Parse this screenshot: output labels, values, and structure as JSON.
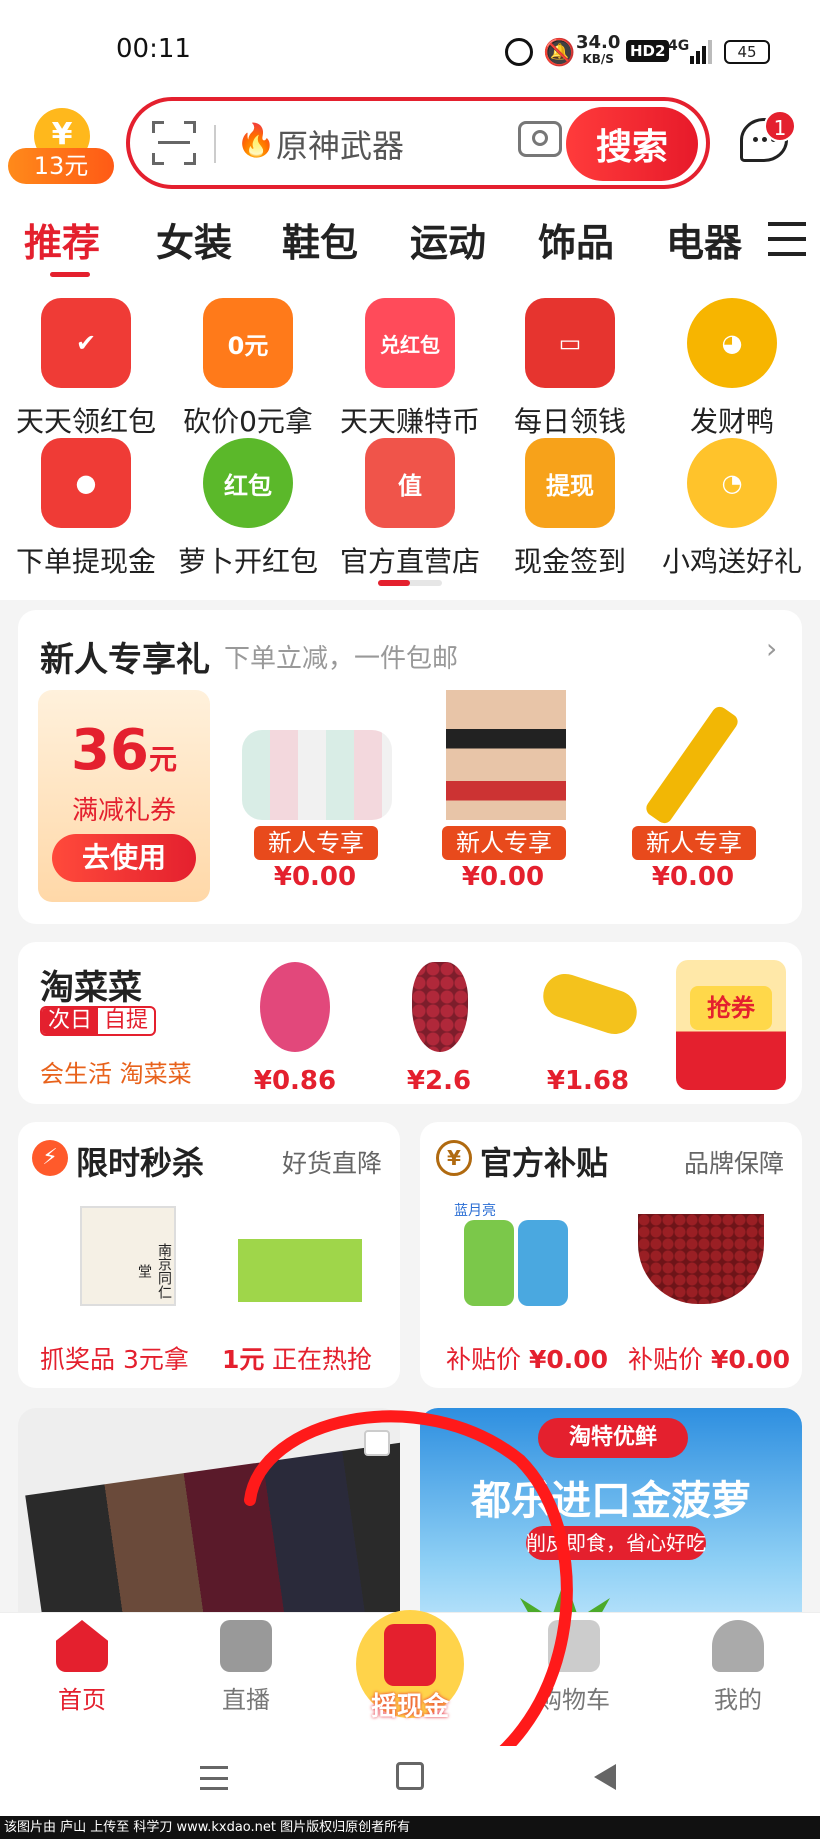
{
  "status_bar": {
    "time": "00:11",
    "speed": "34.0",
    "speed_unit": "KB/S",
    "hd": "HD2",
    "net": "4G",
    "battery": "45"
  },
  "header": {
    "coin_amount": "13元",
    "coin_symbol": "¥",
    "search_placeholder": "原神武器",
    "search_button": "搜索",
    "message_badge": "1"
  },
  "tabs": [
    "推荐",
    "女装",
    "鞋包",
    "运动",
    "饰品",
    "电器"
  ],
  "grid": [
    {
      "label": "天天领红包",
      "icon": "red-envelope-icon",
      "color": "#ef3b36",
      "badge": ""
    },
    {
      "label": "砍价0元拿",
      "icon": "gift-box-icon",
      "color": "#ff7a1a",
      "badge": "0元"
    },
    {
      "label": "天天赚特币",
      "icon": "cat-icon",
      "color": "#ff4b5a",
      "badge": "兑红包"
    },
    {
      "label": "每日领钱",
      "icon": "wallet-icon",
      "color": "#e6342f",
      "badge": ""
    },
    {
      "label": "发财鸭",
      "icon": "duck-icon",
      "color": "#f7b500",
      "badge": ""
    },
    {
      "label": "下单提现金",
      "icon": "envelope-coin-icon",
      "color": "#ef3b36",
      "badge": ""
    },
    {
      "label": "萝卜开红包",
      "icon": "radish-icon",
      "color": "#5bb82a",
      "badge": "红包"
    },
    {
      "label": "官方直营店",
      "icon": "store-icon",
      "color": "#f0544a",
      "badge": "值"
    },
    {
      "label": "现金签到",
      "icon": "coins-icon",
      "color": "#f7a21a",
      "badge": "提现"
    },
    {
      "label": "小鸡送好礼",
      "icon": "chick-icon",
      "color": "#ffc32b",
      "badge": ""
    }
  ],
  "newcomer": {
    "title": "新人专享礼",
    "subtitle": "下单立减，一件包邮",
    "coupon_amount": "36",
    "coupon_unit": "元",
    "coupon_desc": "满减礼券",
    "coupon_button": "去使用",
    "tag": "新人专享",
    "items": [
      {
        "price": "¥0.00"
      },
      {
        "price": "¥0.00"
      },
      {
        "price": "¥0.00"
      }
    ]
  },
  "taocaicai": {
    "title": "淘菜菜",
    "badge_a": "次日",
    "badge_b": "自提",
    "slogan": "会生活 淘菜菜",
    "items": [
      {
        "price": "¥0.86"
      },
      {
        "price": "¥2.6"
      },
      {
        "price": "¥1.68"
      }
    ],
    "coupon": "抢券"
  },
  "flash": {
    "title": "限时秒杀",
    "subtitle": "好货直降",
    "item1": "抓奖品 3元拿",
    "item2_price": "1元",
    "item2_text": "正在热抢",
    "product_text": "南京同仁堂"
  },
  "subsidy": {
    "title": "官方补贴",
    "subtitle": "品牌保障",
    "icon": "¥",
    "item1_label": "补贴价",
    "item1_price": "¥0.00",
    "item2_label": "补贴价",
    "item2_price": "¥0.00",
    "brand": "蓝月亮"
  },
  "promo": {
    "tag": "淘特优鲜",
    "title": "都乐进口金菠萝",
    "sub": "削皮即食，省心好吃"
  },
  "bottom_nav": [
    {
      "label": "首页"
    },
    {
      "label": "直播"
    },
    {
      "label": "摇现金"
    },
    {
      "label": "购物车"
    },
    {
      "label": "我的"
    }
  ],
  "watermark": "该图片由 庐山 上传至 科学刀 www.kxdao.net 图片版权归原创者所有"
}
